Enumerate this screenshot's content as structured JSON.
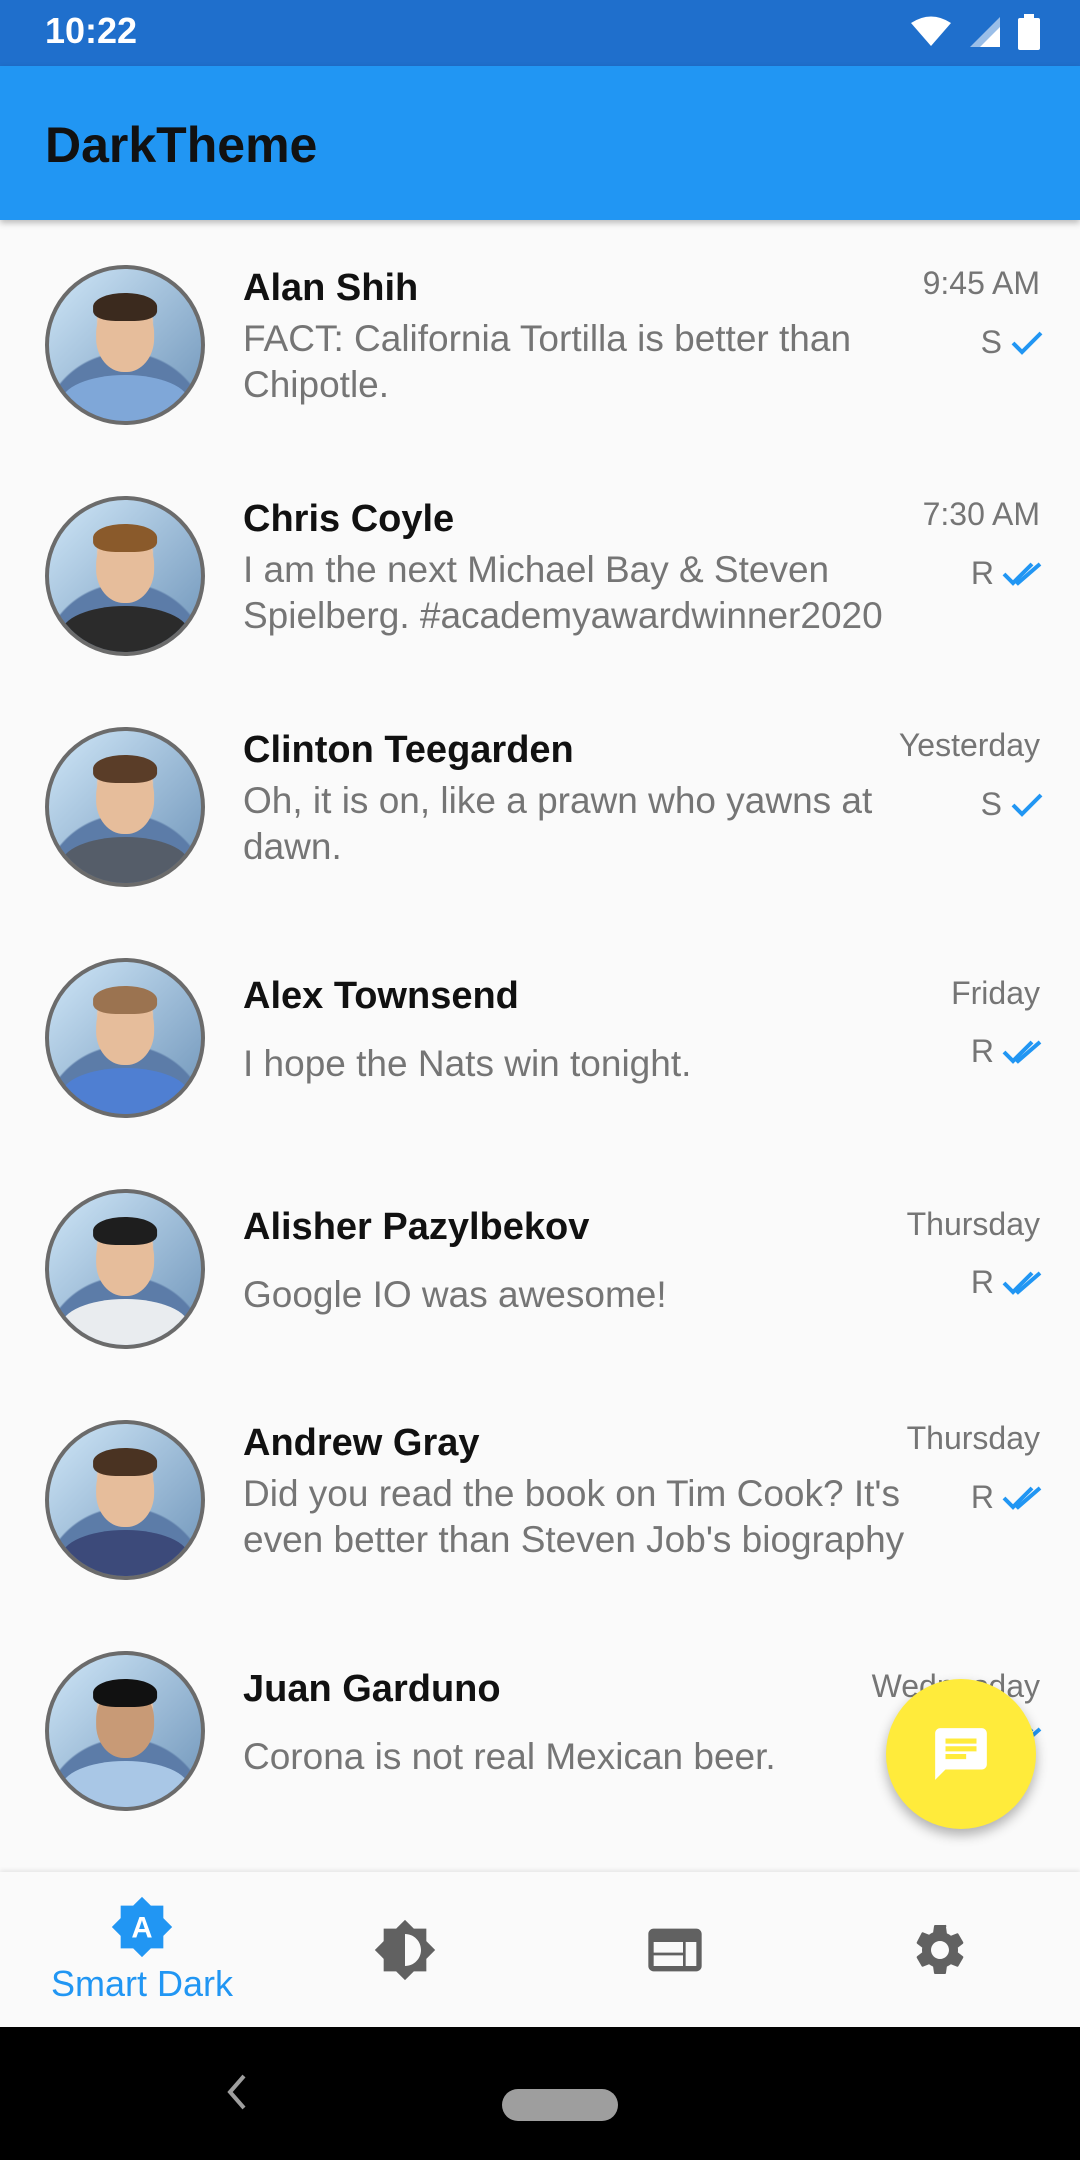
{
  "status_bar": {
    "time": "10:22"
  },
  "app_bar": {
    "title": "DarkTheme"
  },
  "conversations": [
    {
      "name": "Alan Shih",
      "message": "FACT: California Tortilla is better than Chipotle.",
      "time": "9:45 AM",
      "status_letter": "S",
      "status": "sent"
    },
    {
      "name": "Chris Coyle",
      "message": "I am the next Michael Bay & Steven Spielberg. #academyawardwinner2020",
      "time": "7:30 AM",
      "status_letter": "R",
      "status": "read"
    },
    {
      "name": "Clinton Teegarden",
      "message": "Oh, it is on, like a prawn who yawns at dawn.",
      "time": "Yesterday",
      "status_letter": "S",
      "status": "sent"
    },
    {
      "name": "Alex Townsend",
      "message": "I hope the Nats win tonight.",
      "time": "Friday",
      "status_letter": "R",
      "status": "read"
    },
    {
      "name": "Alisher Pazylbekov",
      "message": "Google IO was awesome!",
      "time": "Thursday",
      "status_letter": "R",
      "status": "read"
    },
    {
      "name": "Andrew Gray",
      "message": "Did you read the book on Tim Cook? It's even better than Steven Job's biography",
      "time": "Thursday",
      "status_letter": "R",
      "status": "read"
    },
    {
      "name": "Juan Garduno",
      "message": "Corona is not real Mexican beer.",
      "time": "Wednesday",
      "status_letter": "",
      "status": "read"
    }
  ],
  "fab": {
    "icon": "message-icon",
    "color": "#ffeb3b"
  },
  "bottom_nav": {
    "items": [
      {
        "id": "smart-dark",
        "label": "Smart Dark",
        "icon": "brightness-auto-icon",
        "active": true
      },
      {
        "id": "theme",
        "label": "",
        "icon": "contrast-icon",
        "active": false
      },
      {
        "id": "web",
        "label": "",
        "icon": "web-view-icon",
        "active": false
      },
      {
        "id": "settings",
        "label": "",
        "icon": "settings-gear-icon",
        "active": false
      }
    ]
  },
  "colors": {
    "primary": "#2196f3",
    "status_bar": "#1f6fcc",
    "accent": "#ffeb3b",
    "check": "#2196f3"
  }
}
